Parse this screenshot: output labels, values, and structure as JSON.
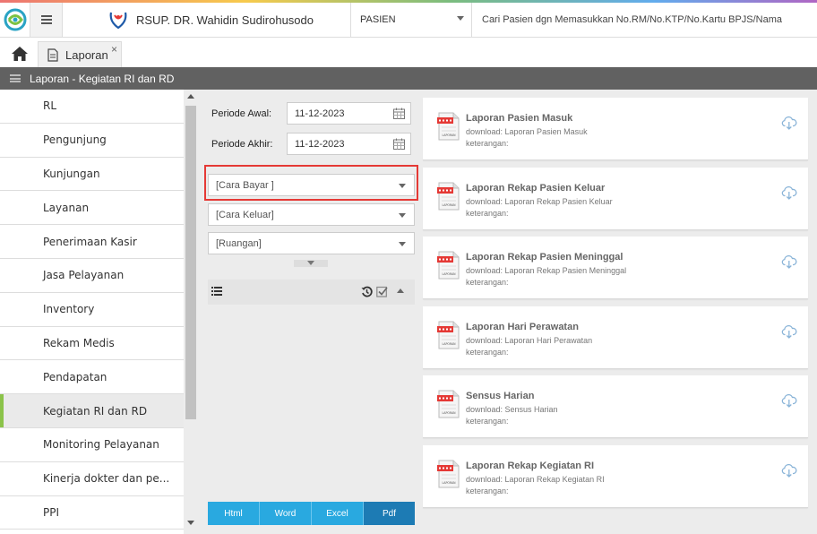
{
  "header": {
    "hospital_name": "RSUP. DR. Wahidin Sudirohusodo",
    "patient_select": "PASIEN",
    "search_placeholder": "Cari Pasien dgn Memasukkan No.RM/No.KTP/No.Kartu BPJS/Nama"
  },
  "tabs": [
    {
      "label": "Laporan",
      "close": "×"
    }
  ],
  "section_title": "Laporan - Kegiatan RI dan RD",
  "sidebar": {
    "items": [
      {
        "label": "RL"
      },
      {
        "label": "Pengunjung"
      },
      {
        "label": "Kunjungan"
      },
      {
        "label": "Layanan"
      },
      {
        "label": "Penerimaan Kasir"
      },
      {
        "label": "Jasa Pelayanan"
      },
      {
        "label": "Inventory"
      },
      {
        "label": "Rekam Medis"
      },
      {
        "label": "Pendapatan"
      },
      {
        "label": "Kegiatan RI dan RD"
      },
      {
        "label": "Monitoring Pelayanan"
      },
      {
        "label": "Kinerja dokter dan pe..."
      },
      {
        "label": "PPI"
      }
    ],
    "active_index": 9
  },
  "filter": {
    "periode_awal_label": "Periode Awal:",
    "periode_awal_value": "11-12-2023",
    "periode_akhir_label": "Periode Akhir:",
    "periode_akhir_value": "11-12-2023",
    "cara_bayar": "[Cara Bayar ]",
    "cara_keluar": "[Cara Keluar]",
    "ruangan": "[Ruangan]"
  },
  "exports": {
    "html": "Html",
    "word": "Word",
    "excel": "Excel",
    "pdf": "Pdf"
  },
  "reports": [
    {
      "title": "Laporan Pasien Masuk",
      "download": "download: Laporan Pasien Masuk",
      "keterangan": "keterangan:"
    },
    {
      "title": "Laporan Rekap Pasien Keluar",
      "download": "download: Laporan Rekap Pasien Keluar",
      "keterangan": "keterangan:"
    },
    {
      "title": "Laporan Rekap Pasien Meninggal",
      "download": "download: Laporan Rekap Pasien Meninggal",
      "keterangan": "keterangan:"
    },
    {
      "title": "Laporan Hari Perawatan",
      "download": "download: Laporan Hari Perawatan",
      "keterangan": "keterangan:"
    },
    {
      "title": "Sensus Harian",
      "download": "download: Sensus Harian",
      "keterangan": "keterangan:"
    },
    {
      "title": "Laporan Rekap Kegiatan RI",
      "download": "download: Laporan Rekap Kegiatan RI",
      "keterangan": "keterangan:"
    }
  ],
  "doc_icon_label": "LAPORAN",
  "colors": {
    "accent_active": "#8bc34a",
    "export_button": "#29a9e0",
    "export_button_active": "#1d7bb4",
    "highlight": "#e53935",
    "section_bar": "#616161"
  }
}
